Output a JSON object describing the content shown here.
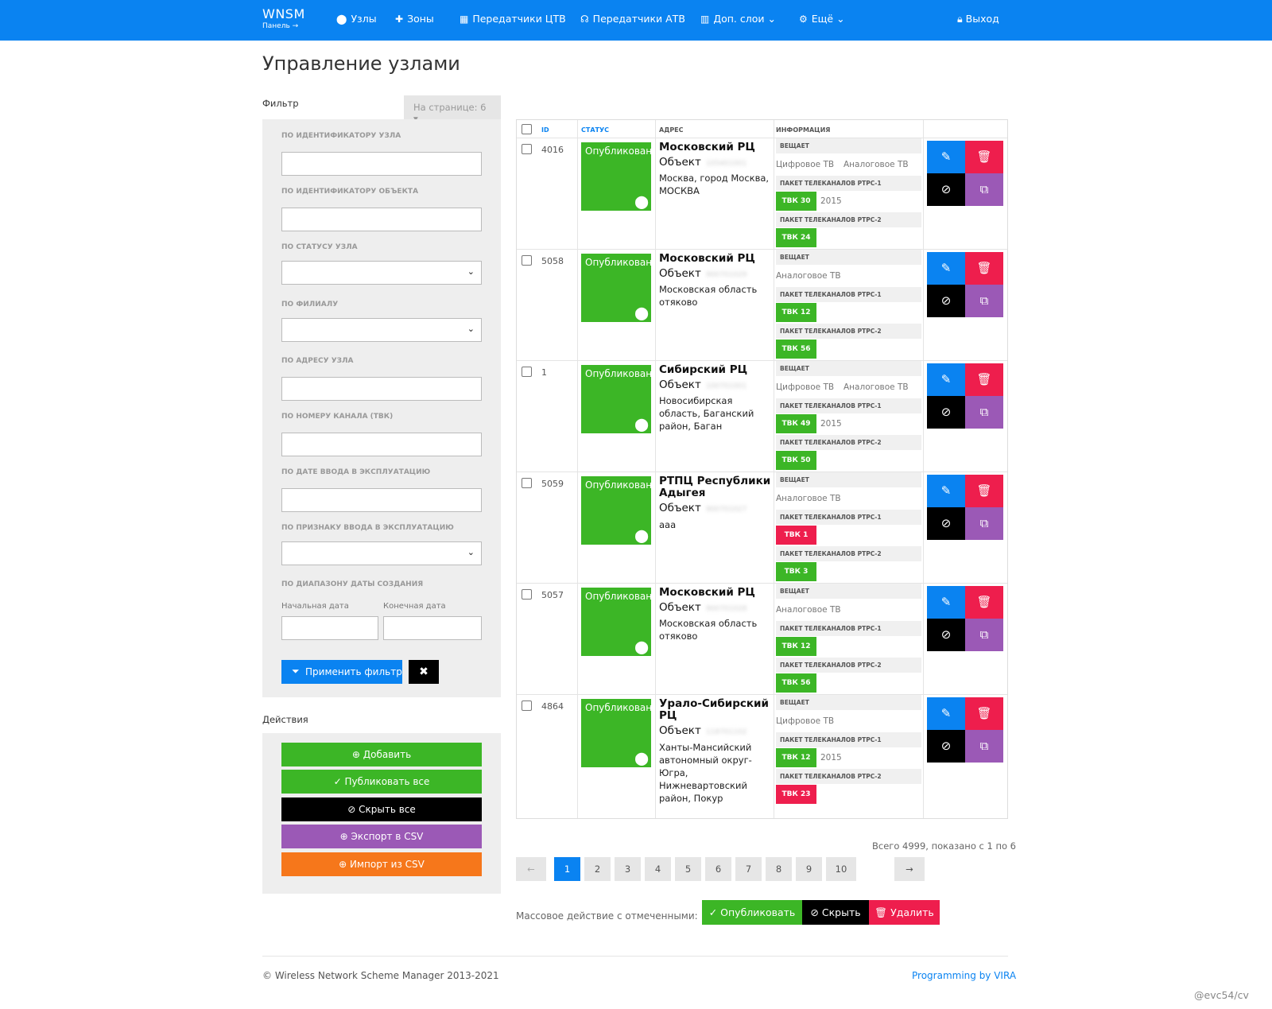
{
  "nav": {
    "brand": "WNSM",
    "brand_sub": "Панель →",
    "items": [
      {
        "label": "Узлы",
        "icon": "map-marker-icon"
      },
      {
        "label": "Зоны",
        "icon": "puzzle-icon"
      },
      {
        "label": "Передатчики ЦТВ",
        "icon": "grid-icon"
      },
      {
        "label": "Передатчики АТВ",
        "icon": "headphones-icon"
      },
      {
        "label": "Доп. слои",
        "icon": "layers-icon"
      },
      {
        "label": "Ещё",
        "icon": "gear-icon"
      }
    ],
    "logout": "Выход"
  },
  "page_title": "Управление узлами",
  "filter": {
    "title": "Фильтр",
    "per_page": "На странице: 6",
    "labels": {
      "node_id": "ПО ИДЕНТИФИКАТОРУ УЗЛА",
      "object_id": "ПО ИДЕНТИФИКАТОРУ ОБЪЕКТА",
      "status": "ПО СТАТУСУ УЗЛА",
      "branch": "ПО ФИЛИАЛУ",
      "address": "ПО АДРЕСУ УЗЛА",
      "channel": "ПО НОМЕРУ КАНАЛА (ТВК)",
      "date": "ПО ДАТЕ ВВОДА В ЭКСПЛУАТАЦИЮ",
      "flag": "ПО ПРИЗНАКУ ВВОДА В ЭКСПЛУАТАЦИЮ",
      "range": "ПО ДИАПАЗОНУ ДАТЫ СОЗДАНИЯ"
    },
    "start_date": "Начальная дата",
    "end_date": "Конечная дата",
    "apply": "Применить фильтр",
    "clear": "✖"
  },
  "actions": {
    "title": "Действия",
    "buttons": [
      {
        "label": "Добавить",
        "color": "#3cb626"
      },
      {
        "label": "Публиковать все",
        "color": "#3cb626"
      },
      {
        "label": "Скрыть все",
        "color": "#000000"
      },
      {
        "label": "Экспорт в CSV",
        "color": "#9b59b6"
      },
      {
        "label": "Импорт из CSV",
        "color": "#f6771b"
      }
    ]
  },
  "table": {
    "headers": {
      "id": "ID",
      "status": "СТАТУС",
      "address": "АДРЕС",
      "info": "ИНФОРМАЦИЯ"
    },
    "info_headers": {
      "broadcast": "ВЕЩАЕТ",
      "pkg1": "ПАКЕТ ТЕЛЕКАНАЛОВ РТРС-1",
      "pkg2": "ПАКЕТ ТЕЛЕКАНАЛОВ РТРС-2"
    },
    "object_label": "Объект",
    "rows": [
      {
        "id": "4016",
        "status": "Опубликован",
        "title": "Московский РЦ",
        "object_id": "105401001",
        "address": "Москва, город Москва, МОСКВА",
        "broadcast": [
          "Цифровое ТВ",
          "Аналоговое ТВ"
        ],
        "pkg1": "ТВК 30",
        "pkg1_color": "#3cb626",
        "pkg1_year": "2015",
        "pkg2": "ТВК 24",
        "pkg2_color": "#3cb626"
      },
      {
        "id": "5058",
        "status": "Опубликован",
        "title": "Московский РЦ",
        "object_id": "900701029",
        "address": "Московская область отяково",
        "broadcast": [
          "Аналоговое ТВ",
          ""
        ],
        "pkg1": "ТВК 12",
        "pkg1_color": "#3cb626",
        "pkg1_year": "",
        "pkg2": "ТВК 56",
        "pkg2_color": "#3cb626"
      },
      {
        "id": "1",
        "status": "Опубликован",
        "title": "Сибирский РЦ",
        "object_id": "100701001",
        "address": "Новосибирская область, Баганский район, Баган",
        "broadcast": [
          "Цифровое ТВ",
          "Аналоговое ТВ"
        ],
        "pkg1": "ТВК 49",
        "pkg1_color": "#3cb626",
        "pkg1_year": "2015",
        "pkg2": "ТВК 50",
        "pkg2_color": "#3cb626"
      },
      {
        "id": "5059",
        "status": "Опубликован",
        "title": "РТПЦ Республики Адыгея",
        "object_id": "900701027",
        "address": "ааа",
        "broadcast": [
          "Аналоговое ТВ",
          ""
        ],
        "pkg1": "ТВК 1",
        "pkg1_color": "#ee1e4d",
        "pkg1_year": "",
        "pkg2": "ТВК 3",
        "pkg2_color": "#3cb626"
      },
      {
        "id": "5057",
        "status": "Опубликован",
        "title": "Московский РЦ",
        "object_id": "900701028",
        "address": "Московская область отяково",
        "broadcast": [
          "Аналоговое ТВ",
          ""
        ],
        "pkg1": "ТВК 12",
        "pkg1_color": "#3cb626",
        "pkg1_year": "",
        "pkg2": "ТВК 56",
        "pkg2_color": "#3cb626"
      },
      {
        "id": "4864",
        "status": "Опубликован",
        "title": "Урало-Сибирский РЦ",
        "object_id": "118701102",
        "address": "Ханты-Мансийский автономный округ-Югра, Нижневартовский район, Покур",
        "broadcast": [
          "Цифровое ТВ",
          ""
        ],
        "pkg1": "ТВК 12",
        "pkg1_color": "#3cb626",
        "pkg1_year": "2015",
        "pkg2": "ТВК 23",
        "pkg2_color": "#ee1e4d"
      }
    ]
  },
  "pagination": {
    "summary": "Всего 4999, показано с 1 по 6",
    "prev": "←",
    "next": "→",
    "pages": [
      "1",
      "2",
      "3",
      "4",
      "5",
      "6",
      "7",
      "8",
      "9",
      "10"
    ],
    "active": "1"
  },
  "mass": {
    "label": "Массовое действие с отмеченными:",
    "publish": "Опубликовать",
    "hide": "Скрыть",
    "delete": "Удалить"
  },
  "footer": {
    "copyright": "© Wireless Network Scheme Manager 2013-2021",
    "credit": "Programming by VIRA"
  },
  "watermark": "@evc54/cv",
  "colors": {
    "primary": "#0a83f1",
    "success": "#3cb626",
    "danger": "#ee1e4d",
    "dark": "#000000",
    "purple": "#9b59b6",
    "orange": "#f6771b"
  }
}
